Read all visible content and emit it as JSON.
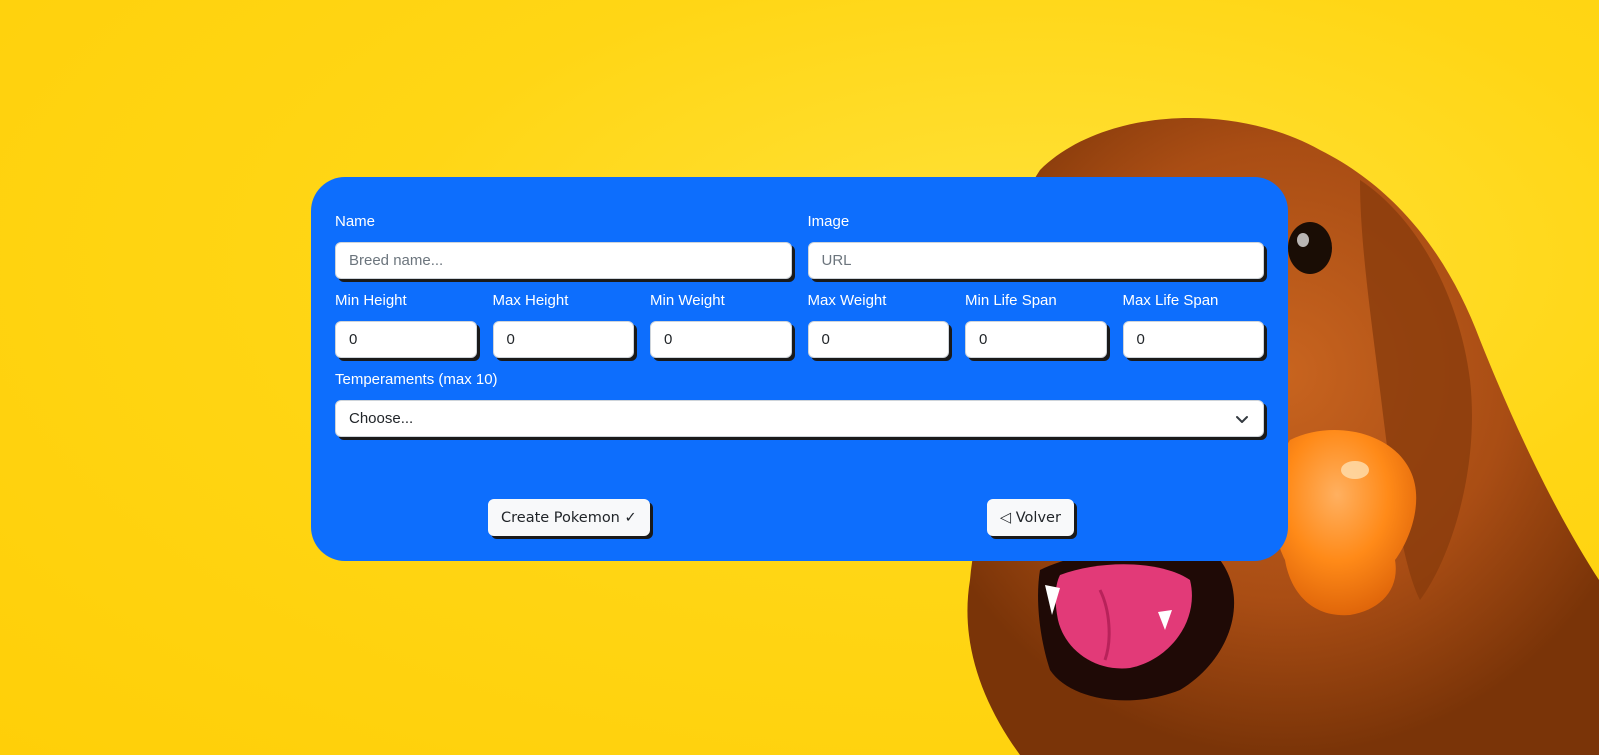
{
  "form": {
    "name": {
      "label": "Name",
      "placeholder": "Breed name..."
    },
    "image": {
      "label": "Image",
      "placeholder": "URL"
    },
    "min_height": {
      "label": "Min Height",
      "value": "0"
    },
    "max_height": {
      "label": "Max Height",
      "value": "0"
    },
    "min_weight": {
      "label": "Min Weight",
      "value": "0"
    },
    "max_weight": {
      "label": "Max Weight",
      "value": "0"
    },
    "min_life_span": {
      "label": "Min Life Span",
      "value": "0"
    },
    "max_life_span": {
      "label": "Max Life Span",
      "value": "0"
    },
    "temperaments": {
      "label": "Temperaments (max 10)",
      "selected": "Choose..."
    }
  },
  "buttons": {
    "create_label": "Create Pokemon ✓",
    "back_label": "◁ Volver"
  },
  "colors": {
    "card": "#0d6efd",
    "background": "#ffd615",
    "button_bg": "#f8f9fa"
  },
  "background_image": "dog-holding-orange-toy-icon"
}
